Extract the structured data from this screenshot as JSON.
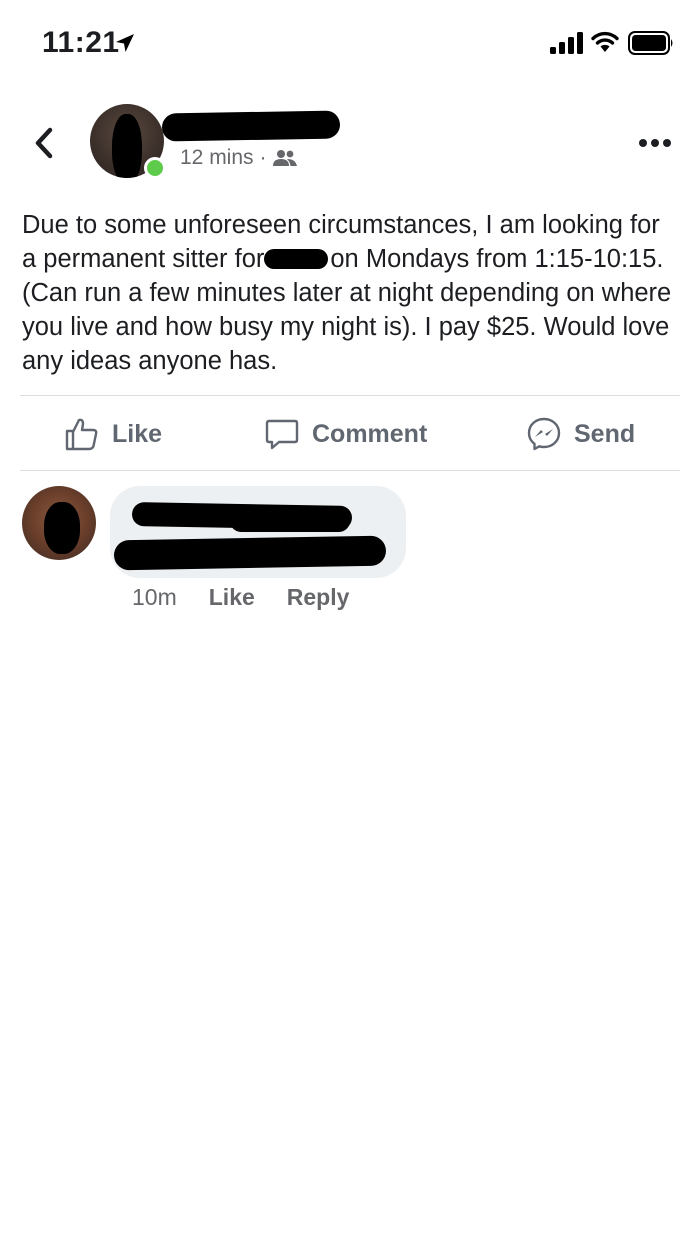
{
  "status_bar": {
    "time": "11:21",
    "icons": [
      "location-arrow-icon",
      "signal-icon",
      "wifi-icon",
      "battery-icon"
    ]
  },
  "post": {
    "author_name": "",
    "timestamp": "12 mins",
    "separator": "·",
    "audience_icon": "friends-icon",
    "body_part1": "Due to some unforeseen circumstances, I am looking for a permanent sitter for",
    "body_part2": "on Mondays from 1:15-10:15. (Can run a few minutes later at night depending on where you live and how busy my night is). I pay $25. Would love any ideas anyone has."
  },
  "actions": {
    "like": "Like",
    "comment": "Comment",
    "send": "Send"
  },
  "comment": {
    "time": "10m",
    "like": "Like",
    "reply": "Reply"
  },
  "colors": {
    "online": "#5fcb4a",
    "action_gray": "#606770",
    "meta_gray": "#65676b",
    "bubble_bg": "#edf0f2",
    "divider": "#dadde1"
  }
}
